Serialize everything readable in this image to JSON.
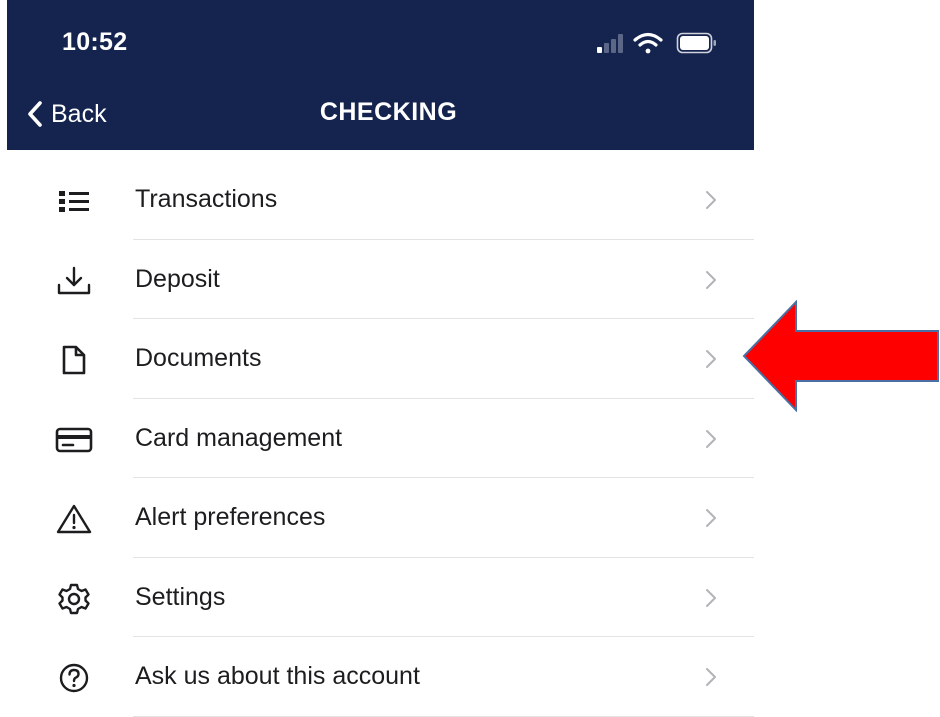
{
  "status_bar": {
    "time": "10:52",
    "icons": [
      "signal-icon",
      "wifi-icon",
      "battery-icon"
    ]
  },
  "nav": {
    "back_label": "Back",
    "title": "CHECKING"
  },
  "colors": {
    "header_bg": "#14244f",
    "annotation_arrow": "#ff0000",
    "annotation_arrow_border": "#4a6fa5",
    "chevron": "#b3b3b8",
    "divider": "#e3e3e6"
  },
  "menu": {
    "items": [
      {
        "label": "Transactions",
        "icon": "list-icon"
      },
      {
        "label": "Deposit",
        "icon": "download-icon"
      },
      {
        "label": "Documents",
        "icon": "document-icon"
      },
      {
        "label": "Card management",
        "icon": "credit-card-icon"
      },
      {
        "label": "Alert preferences",
        "icon": "warning-icon"
      },
      {
        "label": "Settings",
        "icon": "gear-icon"
      },
      {
        "label": "Ask us about this account",
        "icon": "help-circle-icon"
      }
    ]
  },
  "annotation": {
    "points_to": "Documents"
  }
}
